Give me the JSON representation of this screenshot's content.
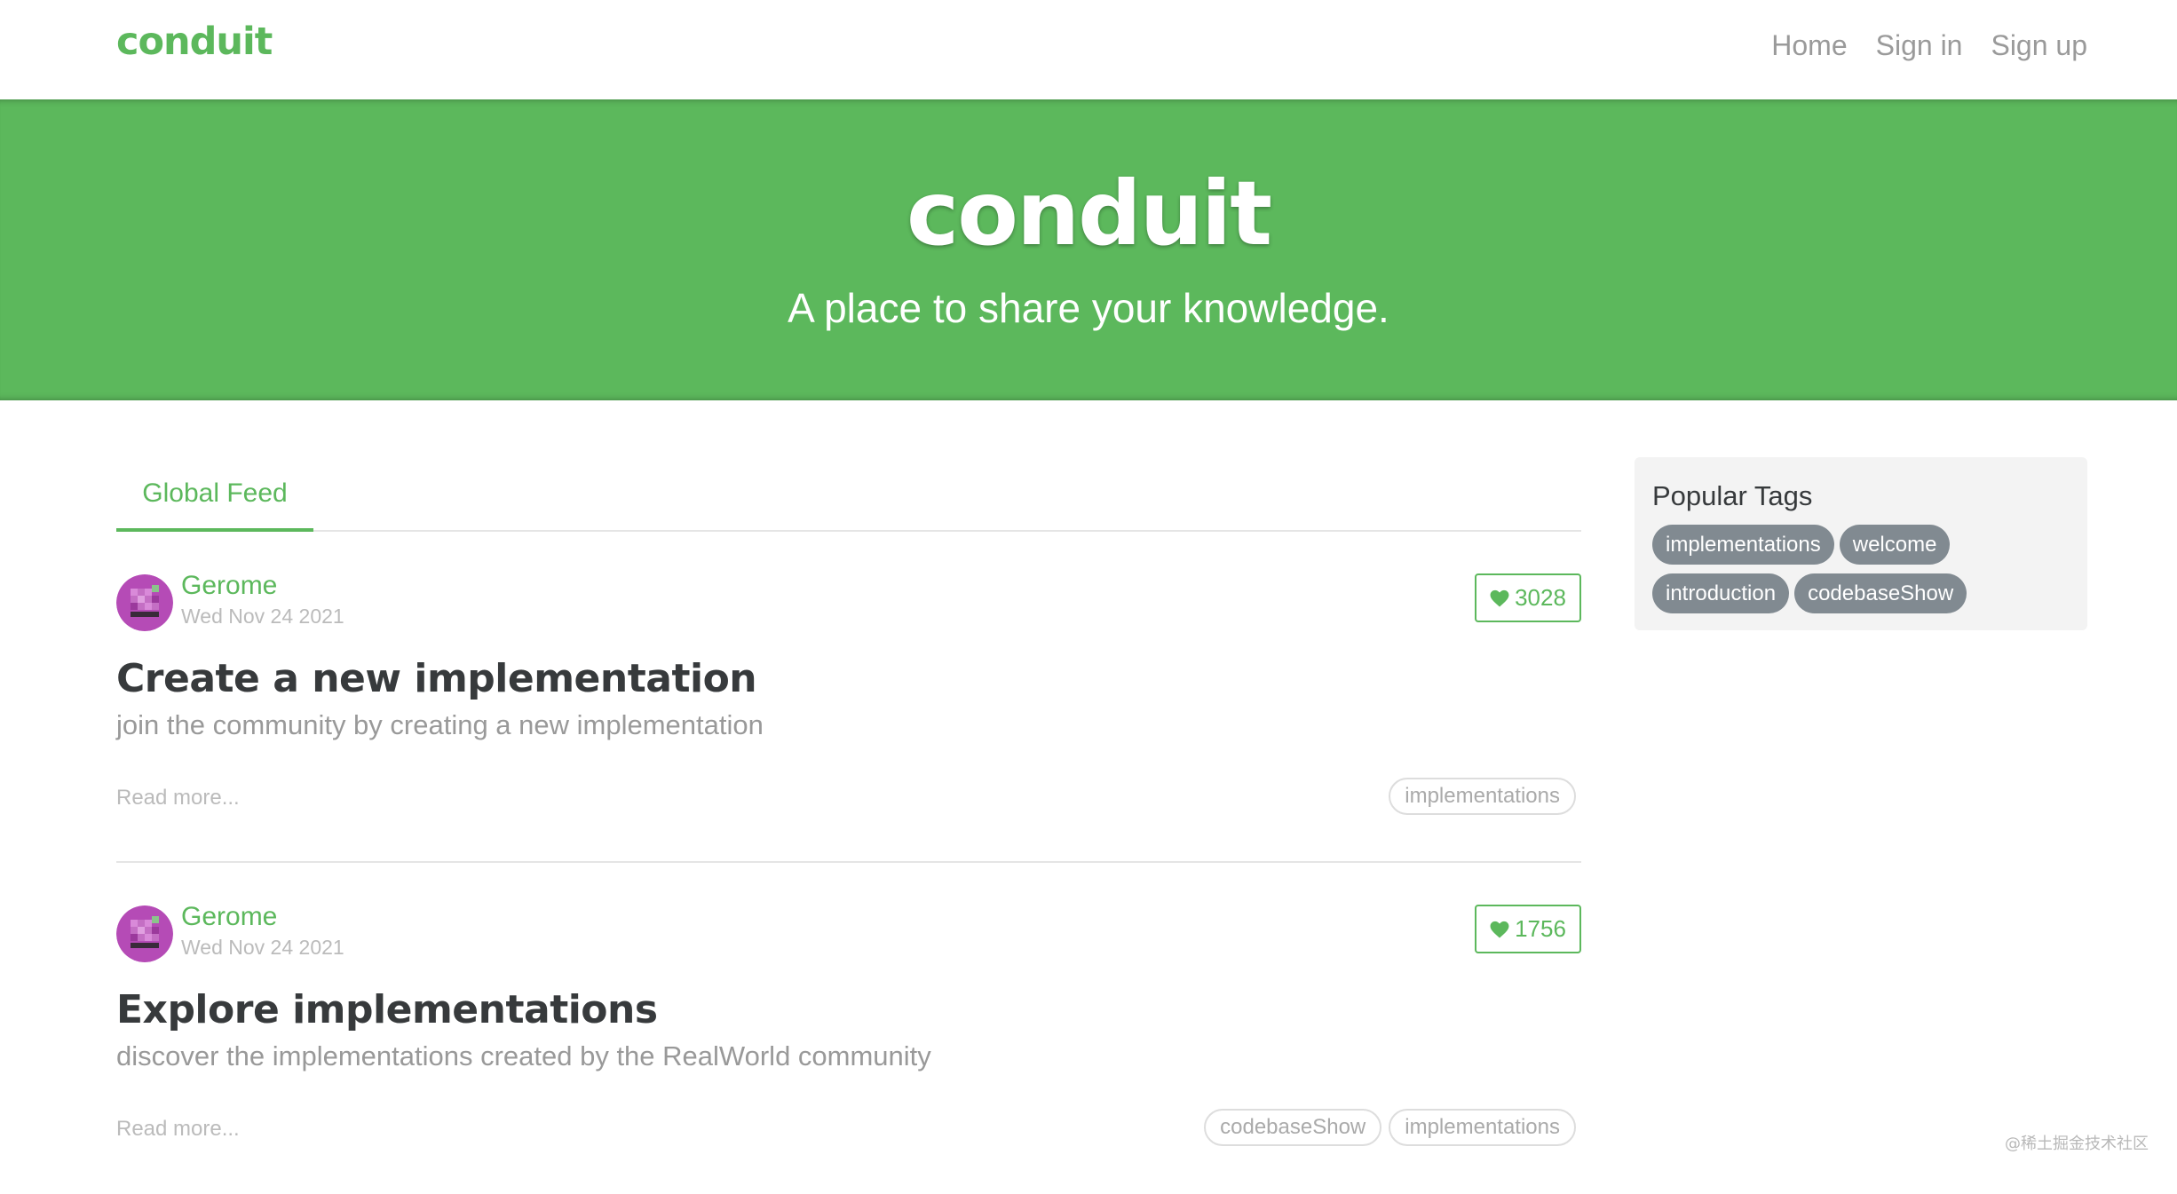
{
  "navbar": {
    "brand": "conduit",
    "links": [
      "Home",
      "Sign in",
      "Sign up"
    ]
  },
  "banner": {
    "title": "conduit",
    "subtitle": "A place to share your knowledge."
  },
  "feed": {
    "tab": "Global Feed",
    "articles": [
      {
        "author": "Gerome",
        "date": "Wed Nov 24 2021",
        "favorites": "3028",
        "title": "Create a new implementation",
        "description": "join the community by creating a new implementation",
        "read_more": "Read more...",
        "tags": [
          "implementations"
        ]
      },
      {
        "author": "Gerome",
        "date": "Wed Nov 24 2021",
        "favorites": "1756",
        "title": "Explore implementations",
        "description": "discover the implementations created by the RealWorld community",
        "read_more": "Read more...",
        "tags": [
          "codebaseShow",
          "implementations"
        ]
      }
    ]
  },
  "sidebar": {
    "title": "Popular Tags",
    "tags": [
      "implementations",
      "welcome",
      "introduction",
      "codebaseShow"
    ]
  },
  "watermark": "@稀土掘金技术社区",
  "colors": {
    "brand": "#5cb85c",
    "tag_pill": "#818a91",
    "sidebar_bg": "#f3f3f3"
  },
  "icons": {
    "favorite": "heart-icon",
    "avatar": "avatar-image"
  }
}
